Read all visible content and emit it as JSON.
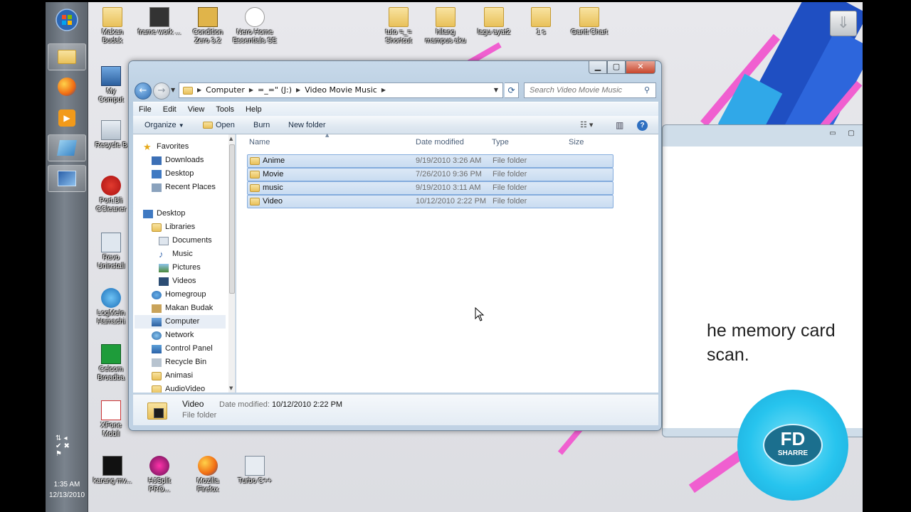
{
  "taskbar": {
    "clock_time": "1:35 AM",
    "clock_date": "12/13/2010"
  },
  "desktop_icons": [
    {
      "label": "Makan\nBudak"
    },
    {
      "label": "frame work ..."
    },
    {
      "label": "Condition\nZero 3.2"
    },
    {
      "label": "Nero Home\nEssentials SE"
    },
    {
      "label": "tuto =_=\nShortcut"
    },
    {
      "label": "hilang\nmampus aku"
    },
    {
      "label": "lagu ayat2"
    },
    {
      "label": "1 s"
    },
    {
      "label": "Gantt Chart"
    },
    {
      "label": "My\nComput"
    },
    {
      "label": "Recycle B"
    },
    {
      "label": "Port.Bli\nCCleaner"
    },
    {
      "label": "Revo\nUninstall"
    },
    {
      "label": "LogMeIn\nHamachi"
    },
    {
      "label": "Celcom\nBroadba"
    },
    {
      "label": "XFone\nMobil"
    },
    {
      "label": "karang mv..."
    },
    {
      "label": "HJSplit PRO..."
    },
    {
      "label": "Mozilla\nFirefox"
    },
    {
      "label": "Turbo C++"
    }
  ],
  "back_window": {
    "text_line1": "he memory card",
    "text_line2": "scan."
  },
  "explorer": {
    "address": [
      "Computer",
      "=_=\" (J:)",
      "Video Movie Music"
    ],
    "search_placeholder": "Search Video Movie Music",
    "menu": [
      "File",
      "Edit",
      "View",
      "Tools",
      "Help"
    ],
    "toolbar": {
      "organize": "Organize",
      "open": "Open",
      "burn": "Burn",
      "new_folder": "New folder"
    },
    "nav": [
      {
        "label": "Favorites"
      },
      {
        "label": "Downloads"
      },
      {
        "label": "Desktop"
      },
      {
        "label": "Recent Places"
      },
      {
        "label": "Desktop"
      },
      {
        "label": "Libraries"
      },
      {
        "label": "Documents"
      },
      {
        "label": "Music"
      },
      {
        "label": "Pictures"
      },
      {
        "label": "Videos"
      },
      {
        "label": "Homegroup"
      },
      {
        "label": "Makan Budak"
      },
      {
        "label": "Computer"
      },
      {
        "label": "Network"
      },
      {
        "label": "Control Panel"
      },
      {
        "label": "Recycle Bin"
      },
      {
        "label": "Animasi"
      },
      {
        "label": "AudioVideo"
      }
    ],
    "columns": {
      "name": "Name",
      "date": "Date modified",
      "type": "Type",
      "size": "Size"
    },
    "files": [
      {
        "name": "Anime",
        "date": "9/19/2010 3:26 AM",
        "type": "File folder"
      },
      {
        "name": "Movie",
        "date": "7/26/2010 9:36 PM",
        "type": "File folder"
      },
      {
        "name": "music",
        "date": "9/19/2010 3:11 AM",
        "type": "File folder"
      },
      {
        "name": "Video",
        "date": "10/12/2010 2:22 PM",
        "type": "File folder"
      }
    ],
    "details": {
      "name": "Video",
      "type": "File folder",
      "date_label": "Date modified:",
      "date_value": "10/12/2010 2:22 PM"
    }
  },
  "watermark": {
    "line1": "FD",
    "line2": "SHARRE"
  }
}
